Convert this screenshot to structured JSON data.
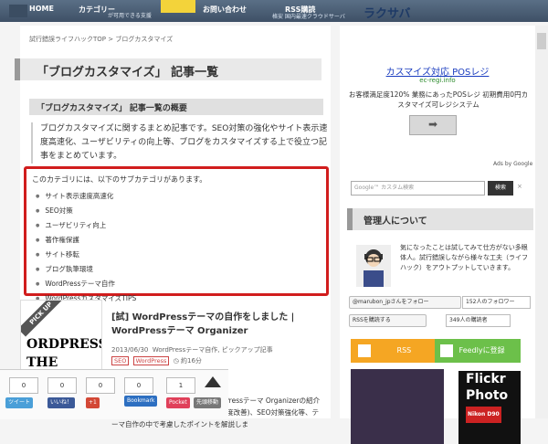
{
  "header": {
    "home_label": "HOME",
    "nav_category": "カテゴリー",
    "nav_tagline": "が可用できる支援",
    "nav_contact": "お問い合わせ",
    "nav_rss": "RSS購読",
    "banner_sub": "格安 国内最速クラウドサーバ",
    "banner_logo": "ラクサバ"
  },
  "breadcrumb": "試行錯誤ライフハックTOP > ブログカスタマイズ",
  "page_title": "「ブログカスタマイズ」 記事一覧",
  "overview_title": "「ブログカスタマイズ」 記事一覧の概要",
  "overview_text": "ブログカスタマイズに関するまとめ記事です。SEO対策の強化やサイト表示速度高速化、ユーザビリティの向上等、ブログをカスタマイズする上で役立つ記事をまとめています。",
  "subcategory": {
    "intro": "このカテゴリには、以下のサブカテゴリがあります。",
    "items": [
      "サイト表示速度高速化",
      "SEO対策",
      "ユーザビリティ向上",
      "著作権保護",
      "サイト移転",
      "ブログ執筆環境",
      "WordPressテーマ自作",
      "WordPressカスタマイズTIPS"
    ]
  },
  "post": {
    "pickup": "PICK UP",
    "thumb_text": "ORDPRESS THE ORGANIZER",
    "title": "[試] WordPressテーマの自作をしました | WordPressテーマ Organizer",
    "date": "2013/06/30",
    "categories": "WordPressテーマ自作, ピックアップ記事",
    "tag_seo": "SEO",
    "tag_wp": "WordPress",
    "read_time": "約16分",
    "excerpt": "セプトを参考にしながら自作のWordPressテーマ Organizerの紹介です。ユーザビリティやサイト表示速度改善)、SEO対策強化等、テーマ自作の中で考慮したポイントを解説しま"
  },
  "share": {
    "count_0a": "0",
    "count_0b": "0",
    "count_0c": "0",
    "count_0d": "0",
    "count_1": "1",
    "tweet_label": "ツイート",
    "like_label": "いいね！",
    "gplus_label": "+1",
    "bookmark_label": "Bookmark",
    "pocket_label": "Pocket",
    "feedly_label": "先頭移動"
  },
  "ad": {
    "title": "カスマイズ対応 POSレジ",
    "url": "ec-regi.info",
    "text": "お客様満足度120% 業務にあったPOSレジ 初期費用0円カスタマイズ可レジシステム",
    "button_symbol": "➡",
    "adsby": "Ads by Google"
  },
  "search": {
    "placeholder": "Google™ カスタム検索",
    "button": "検索",
    "close": "×"
  },
  "admin": {
    "heading": "管理人について",
    "text": "気になったことは試してみて仕方がない多眼体人。試行錯誤しながら様々な工夫（ライフハック）をアウトプットしていきます。"
  },
  "social": {
    "follow": "@marubon_jpさんをフォロー",
    "follower_count": "152人のフォロワー",
    "rss_register": "RSSを購読する",
    "rss_count": "349人の購読者",
    "rss_btn": "RSS",
    "feedly_btn": "Feedlyに登録"
  },
  "flickr": {
    "line1": "Flickr",
    "line2": "Photo",
    "line3": "Nikon D90"
  }
}
